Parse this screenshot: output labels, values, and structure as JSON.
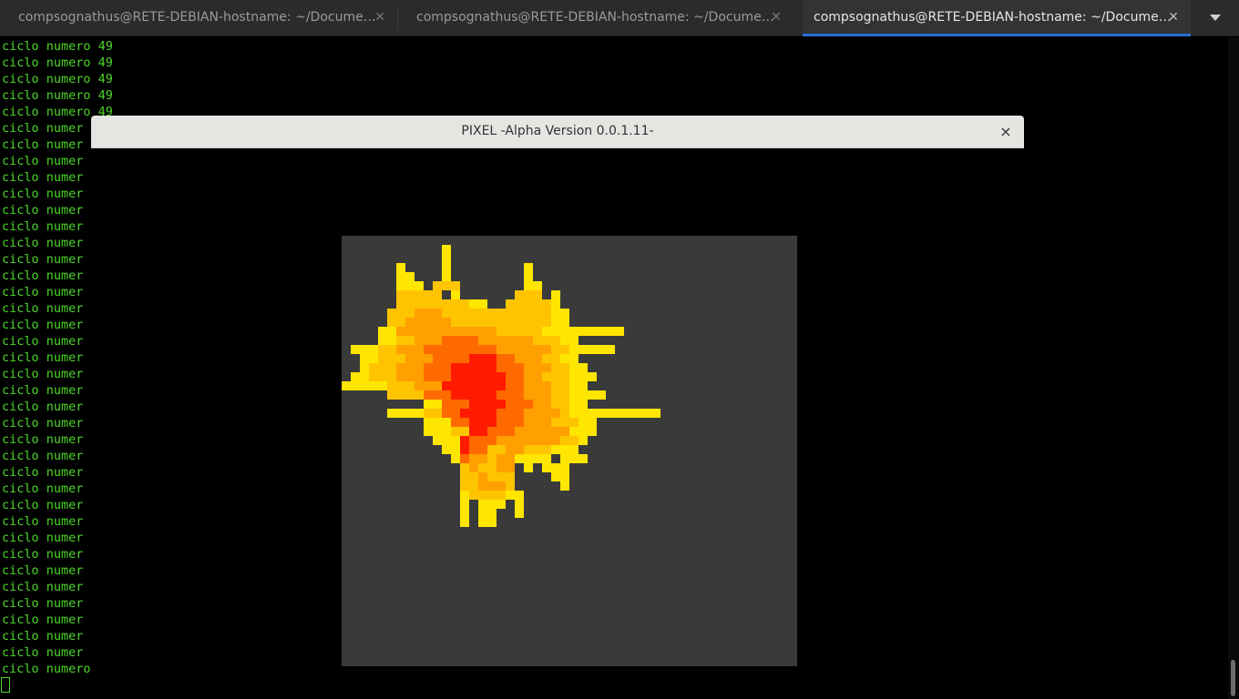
{
  "tabs": [
    {
      "label": "compsognathus@RETE-DEBIAN-hostname: ~/Docume…",
      "active": false
    },
    {
      "label": "compsognathus@RETE-DEBIAN-hostname: ~/Docume…",
      "active": false
    },
    {
      "label": "compsognathus@RETE-DEBIAN-hostname: ~/Docume…",
      "active": true
    }
  ],
  "icons": {
    "tab_close": "close-icon",
    "tab_menu": "chevron-down-icon",
    "window_close": "close-icon"
  },
  "colors": {
    "terminal_text": "#4dd62a",
    "canvas_bg": "#3a3a3a",
    "active_tab_indicator": "#2a6fd6"
  },
  "terminal": {
    "full_line": "ciclo numero 49",
    "partial_line": "ciclo numer",
    "tail_fragment": "o 49",
    "line_count": 39
  },
  "window": {
    "title": "PIXEL -Alpha Version 0.0.1.11-",
    "close_label": "×"
  }
}
